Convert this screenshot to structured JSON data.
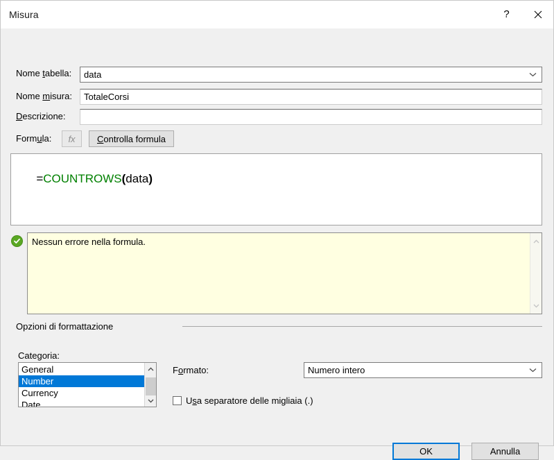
{
  "window": {
    "title": "Misura",
    "help_icon": "question-mark-icon",
    "close_icon": "close-icon"
  },
  "fields": {
    "table_name": {
      "label_pre": "Nome ",
      "label_accel": "t",
      "label_post": "abella:",
      "value": "data",
      "dropdown_icon": "chevron-down-icon"
    },
    "measure_name": {
      "label_pre": "Nome ",
      "label_accel": "m",
      "label_post": "isura:",
      "value": "TotaleCorsi"
    },
    "description": {
      "label_accel": "D",
      "label_post": "escrizione:",
      "value": "",
      "placeholder": ""
    }
  },
  "formula_section": {
    "label_pre": "Form",
    "label_accel": "u",
    "label_post": "la:",
    "fx_button": "fx",
    "check_button": {
      "pre": "",
      "accel": "C",
      "post": "ontrolla formula"
    },
    "formula_text": "=COUNTROWS(data)",
    "formula_tokens": [
      {
        "text": "=",
        "kind": "operator"
      },
      {
        "text": "COUNTROWS",
        "kind": "function"
      },
      {
        "text": "(",
        "kind": "paren"
      },
      {
        "text": "data",
        "kind": "plain"
      },
      {
        "text": ")",
        "kind": "paren"
      }
    ],
    "status_icon": "success-check-icon",
    "status_message": "Nessun errore nella formula."
  },
  "format_options": {
    "group_label": "Opzioni di formattazione",
    "category": {
      "label": "Categoria:",
      "items": [
        "General",
        "Number",
        "Currency",
        "Date"
      ],
      "selected": "Number"
    },
    "format": {
      "label_pre": "F",
      "label_accel": "o",
      "label_post": "rmato:",
      "value": "Numero intero",
      "dropdown_icon": "chevron-down-icon"
    },
    "thousands_checkbox": {
      "checked": false,
      "label_pre": "U",
      "label_accel": "s",
      "label_post": "a separatore delle migliaia (.)"
    }
  },
  "buttons": {
    "ok": "OK",
    "cancel": "Annulla"
  },
  "colors": {
    "dialog_bg": "#f0f0f0",
    "selection_blue": "#0078d7",
    "function_green": "#008000",
    "message_bg": "#ffffe1",
    "success_green": "#5aa823"
  }
}
